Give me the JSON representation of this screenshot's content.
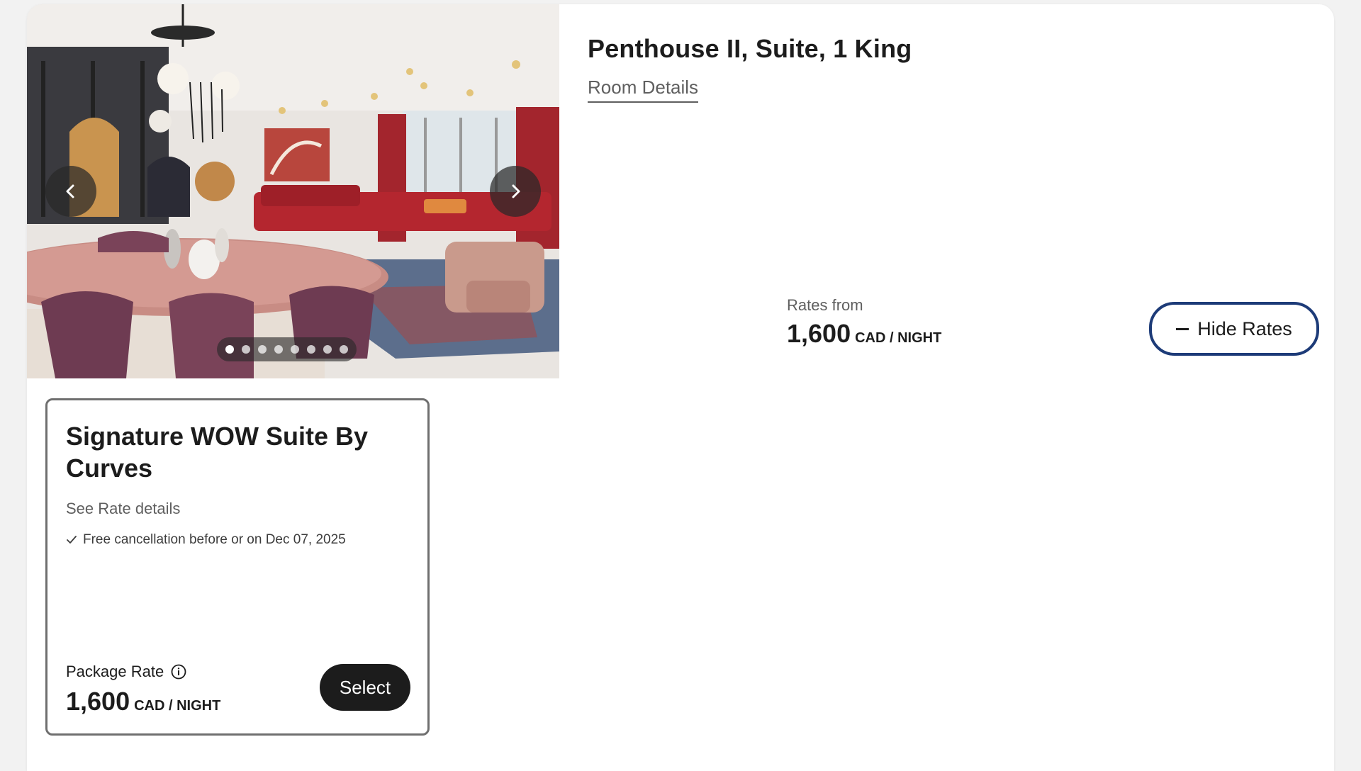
{
  "room": {
    "title": "Penthouse II, Suite, 1 King",
    "details_link": "Room Details",
    "rates_from_label": "Rates from",
    "price": "1,600",
    "price_unit": "CAD / NIGHT",
    "hide_rates_label": "Hide Rates"
  },
  "carousel": {
    "prev_icon": "chevron-left-icon",
    "next_icon": "chevron-right-icon",
    "dot_count": 8,
    "active_dot": 1
  },
  "rate_card": {
    "name": "Signature WOW Suite By Curves",
    "see_details": "See Rate details",
    "cancellation": "Free cancellation before or on Dec 07, 2025",
    "package_label": "Package Rate",
    "price": "1,600",
    "price_unit": "CAD / NIGHT",
    "select_label": "Select"
  },
  "colors": {
    "accent_border": "#1d3b78",
    "select_bg": "#1c1c1c"
  }
}
